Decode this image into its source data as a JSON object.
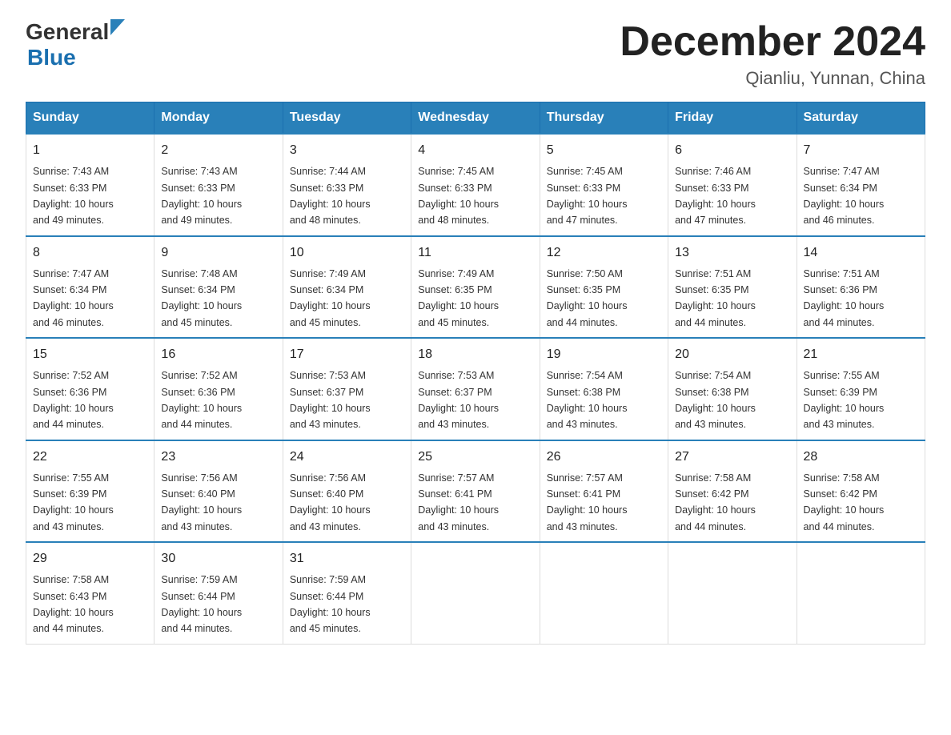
{
  "header": {
    "logo_general": "General",
    "logo_blue": "Blue",
    "title": "December 2024",
    "subtitle": "Qianliu, Yunnan, China"
  },
  "weekdays": [
    "Sunday",
    "Monday",
    "Tuesday",
    "Wednesday",
    "Thursday",
    "Friday",
    "Saturday"
  ],
  "weeks": [
    [
      {
        "day": "1",
        "sunrise": "7:43 AM",
        "sunset": "6:33 PM",
        "daylight": "10 hours and 49 minutes."
      },
      {
        "day": "2",
        "sunrise": "7:43 AM",
        "sunset": "6:33 PM",
        "daylight": "10 hours and 49 minutes."
      },
      {
        "day": "3",
        "sunrise": "7:44 AM",
        "sunset": "6:33 PM",
        "daylight": "10 hours and 48 minutes."
      },
      {
        "day": "4",
        "sunrise": "7:45 AM",
        "sunset": "6:33 PM",
        "daylight": "10 hours and 48 minutes."
      },
      {
        "day": "5",
        "sunrise": "7:45 AM",
        "sunset": "6:33 PM",
        "daylight": "10 hours and 47 minutes."
      },
      {
        "day": "6",
        "sunrise": "7:46 AM",
        "sunset": "6:33 PM",
        "daylight": "10 hours and 47 minutes."
      },
      {
        "day": "7",
        "sunrise": "7:47 AM",
        "sunset": "6:34 PM",
        "daylight": "10 hours and 46 minutes."
      }
    ],
    [
      {
        "day": "8",
        "sunrise": "7:47 AM",
        "sunset": "6:34 PM",
        "daylight": "10 hours and 46 minutes."
      },
      {
        "day": "9",
        "sunrise": "7:48 AM",
        "sunset": "6:34 PM",
        "daylight": "10 hours and 45 minutes."
      },
      {
        "day": "10",
        "sunrise": "7:49 AM",
        "sunset": "6:34 PM",
        "daylight": "10 hours and 45 minutes."
      },
      {
        "day": "11",
        "sunrise": "7:49 AM",
        "sunset": "6:35 PM",
        "daylight": "10 hours and 45 minutes."
      },
      {
        "day": "12",
        "sunrise": "7:50 AM",
        "sunset": "6:35 PM",
        "daylight": "10 hours and 44 minutes."
      },
      {
        "day": "13",
        "sunrise": "7:51 AM",
        "sunset": "6:35 PM",
        "daylight": "10 hours and 44 minutes."
      },
      {
        "day": "14",
        "sunrise": "7:51 AM",
        "sunset": "6:36 PM",
        "daylight": "10 hours and 44 minutes."
      }
    ],
    [
      {
        "day": "15",
        "sunrise": "7:52 AM",
        "sunset": "6:36 PM",
        "daylight": "10 hours and 44 minutes."
      },
      {
        "day": "16",
        "sunrise": "7:52 AM",
        "sunset": "6:36 PM",
        "daylight": "10 hours and 44 minutes."
      },
      {
        "day": "17",
        "sunrise": "7:53 AM",
        "sunset": "6:37 PM",
        "daylight": "10 hours and 43 minutes."
      },
      {
        "day": "18",
        "sunrise": "7:53 AM",
        "sunset": "6:37 PM",
        "daylight": "10 hours and 43 minutes."
      },
      {
        "day": "19",
        "sunrise": "7:54 AM",
        "sunset": "6:38 PM",
        "daylight": "10 hours and 43 minutes."
      },
      {
        "day": "20",
        "sunrise": "7:54 AM",
        "sunset": "6:38 PM",
        "daylight": "10 hours and 43 minutes."
      },
      {
        "day": "21",
        "sunrise": "7:55 AM",
        "sunset": "6:39 PM",
        "daylight": "10 hours and 43 minutes."
      }
    ],
    [
      {
        "day": "22",
        "sunrise": "7:55 AM",
        "sunset": "6:39 PM",
        "daylight": "10 hours and 43 minutes."
      },
      {
        "day": "23",
        "sunrise": "7:56 AM",
        "sunset": "6:40 PM",
        "daylight": "10 hours and 43 minutes."
      },
      {
        "day": "24",
        "sunrise": "7:56 AM",
        "sunset": "6:40 PM",
        "daylight": "10 hours and 43 minutes."
      },
      {
        "day": "25",
        "sunrise": "7:57 AM",
        "sunset": "6:41 PM",
        "daylight": "10 hours and 43 minutes."
      },
      {
        "day": "26",
        "sunrise": "7:57 AM",
        "sunset": "6:41 PM",
        "daylight": "10 hours and 43 minutes."
      },
      {
        "day": "27",
        "sunrise": "7:58 AM",
        "sunset": "6:42 PM",
        "daylight": "10 hours and 44 minutes."
      },
      {
        "day": "28",
        "sunrise": "7:58 AM",
        "sunset": "6:42 PM",
        "daylight": "10 hours and 44 minutes."
      }
    ],
    [
      {
        "day": "29",
        "sunrise": "7:58 AM",
        "sunset": "6:43 PM",
        "daylight": "10 hours and 44 minutes."
      },
      {
        "day": "30",
        "sunrise": "7:59 AM",
        "sunset": "6:44 PM",
        "daylight": "10 hours and 44 minutes."
      },
      {
        "day": "31",
        "sunrise": "7:59 AM",
        "sunset": "6:44 PM",
        "daylight": "10 hours and 45 minutes."
      },
      null,
      null,
      null,
      null
    ]
  ],
  "labels": {
    "sunrise": "Sunrise:",
    "sunset": "Sunset:",
    "daylight": "Daylight:"
  }
}
